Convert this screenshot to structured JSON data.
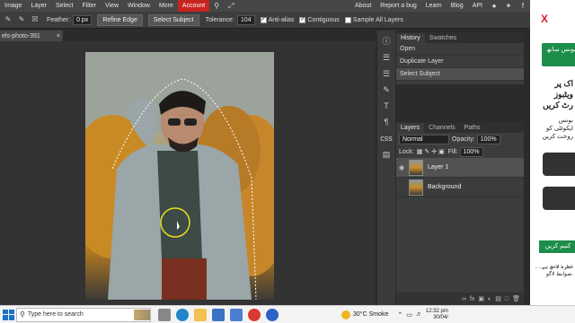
{
  "menu": {
    "items": [
      "Image",
      "Layer",
      "Select",
      "Filter",
      "View",
      "Window",
      "More"
    ],
    "active": "Account",
    "right": [
      "About",
      "Report a bug",
      "Learn",
      "Blog",
      "API"
    ]
  },
  "options": {
    "feather_label": "Feather:",
    "feather_value": "0 px",
    "refine_edge": "Refine Edge",
    "select_subject": "Select Subject",
    "tolerance_label": "Tolerance:",
    "tolerance_value": "104",
    "anti_alias": "Anti-alias",
    "contiguous": "Contiguous",
    "sample_all": "Sample All Layers"
  },
  "document": {
    "tab_name": "els-photo-391",
    "close": "×"
  },
  "history": {
    "tabs": [
      "History",
      "Swatches"
    ],
    "items": [
      "Open",
      "Duplicate Layer",
      "Select Subject"
    ]
  },
  "layers": {
    "tabs": [
      "Layers",
      "Channels",
      "Paths"
    ],
    "blend_mode": "Normal",
    "opacity_label": "Opacity:",
    "opacity_value": "100%",
    "lock_label": "Lock:",
    "fill_label": "Fill:",
    "fill_value": "100%",
    "items": [
      {
        "name": "Layer 1",
        "selected": true,
        "visible": true
      },
      {
        "name": "Background",
        "selected": false,
        "visible": false
      }
    ]
  },
  "ad": {
    "logo": "X",
    "button_text": "بونس ساتھ",
    "line1": "اک پر",
    "line2": "ویٹبوز",
    "line3": "رٹ کریں",
    "small1": "بونس",
    "small2": "ایکوئٹی کو",
    "small3": "روخت کریں",
    "cta": "کنیم کریں",
    "footer1": "، خطرہ لاحق ہے۔",
    "footer2": "ضوابط لاگو."
  },
  "taskbar": {
    "search_placeholder": "Type here to search",
    "weather": "30°C  Smoke",
    "time": "12:32 pm",
    "date": "30/04/"
  }
}
